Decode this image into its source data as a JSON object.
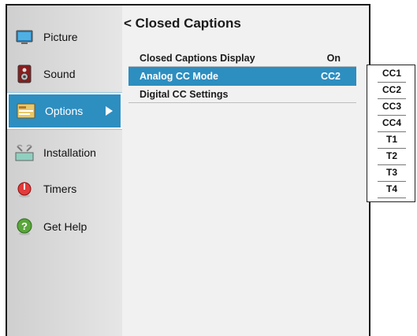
{
  "sidebar": {
    "items": [
      {
        "label": "Picture",
        "icon": "picture-icon"
      },
      {
        "label": "Sound",
        "icon": "speaker-icon"
      },
      {
        "label": "Options",
        "icon": "options-icon"
      },
      {
        "label": "Installation",
        "icon": "installation-icon"
      },
      {
        "label": "Timers",
        "icon": "timer-icon"
      },
      {
        "label": "Get Help",
        "icon": "help-icon"
      }
    ],
    "selected": "Options"
  },
  "panel": {
    "back_glyph": "<",
    "title": "Closed Captions",
    "rows": [
      {
        "name": "Closed Captions Display",
        "value": "On"
      },
      {
        "name": "Analog CC Mode",
        "value": "CC2"
      },
      {
        "name": "Digital CC Settings",
        "value": ""
      }
    ]
  },
  "cc_options": [
    "CC1",
    "CC2",
    "CC3",
    "CC4",
    "T1",
    "T2",
    "T3",
    "T4"
  ],
  "colors": {
    "highlight": "#2d8ec0",
    "sidebar": "#d9d9d9",
    "panel": "#f1f1f1"
  }
}
